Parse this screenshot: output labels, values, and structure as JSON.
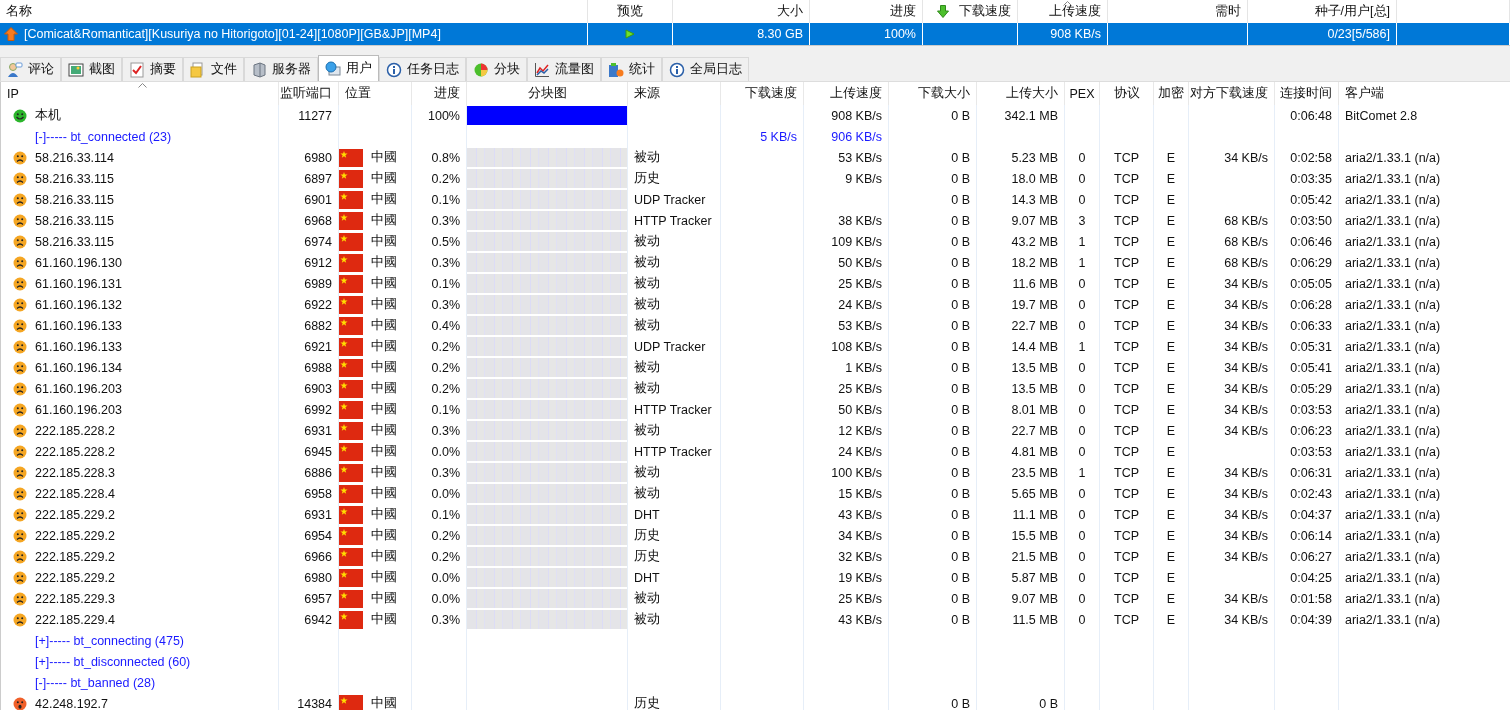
{
  "torrents": {
    "columns": [
      {
        "label": "名称",
        "sorted": false
      },
      {
        "label": "预览",
        "sorted": false
      },
      {
        "label": "大小",
        "sorted": false
      },
      {
        "label": "进度",
        "sorted": false
      },
      {
        "label": "下载速度",
        "sorted": false
      },
      {
        "label": "上传速度",
        "sorted": true
      },
      {
        "label": "需时",
        "sorted": false
      },
      {
        "label": "种子/用户[总]",
        "sorted": false
      }
    ],
    "rows": [
      {
        "selected": true,
        "name": "[Comicat&Romanticat][Kusuriya no Hitorigoto][01-24][1080P][GB&JP][MP4]",
        "size": "8.30 GB",
        "progress": "100%",
        "down": "",
        "up": "908 KB/s",
        "eta": "",
        "peers": "0/23[5/586]"
      }
    ]
  },
  "tabs": [
    {
      "label": "评论",
      "kind": "comment",
      "selected": false
    },
    {
      "label": "截图",
      "kind": "picture",
      "selected": false
    },
    {
      "label": "摘要",
      "kind": "check",
      "selected": false
    },
    {
      "label": "文件",
      "kind": "files",
      "selected": false
    },
    {
      "label": "服务器",
      "kind": "server",
      "selected": false
    },
    {
      "label": "用户",
      "kind": "users",
      "selected": true
    },
    {
      "label": "任务日志",
      "kind": "info",
      "selected": false
    },
    {
      "label": "分块",
      "kind": "pie",
      "selected": false
    },
    {
      "label": "流量图",
      "kind": "chart",
      "selected": false
    },
    {
      "label": "统计",
      "kind": "stats",
      "selected": false
    },
    {
      "label": "全局日志",
      "kind": "info",
      "selected": false
    }
  ],
  "peers": {
    "columns": [
      {
        "label": "IP",
        "sorted": true
      },
      {
        "label": "监听端口",
        "sorted": false
      },
      {
        "label": "位置",
        "sorted": false
      },
      {
        "label": "进度",
        "sorted": false
      },
      {
        "label": "分块图",
        "sorted": false
      },
      {
        "label": "来源",
        "sorted": false
      },
      {
        "label": "下载速度",
        "sorted": false
      },
      {
        "label": "上传速度",
        "sorted": false
      },
      {
        "label": "下载大小",
        "sorted": false
      },
      {
        "label": "上传大小",
        "sorted": false
      },
      {
        "label": "PEX",
        "sorted": false
      },
      {
        "label": "协议",
        "sorted": false
      },
      {
        "label": "加密",
        "sorted": false
      },
      {
        "label": "对方下载速度",
        "sorted": false
      },
      {
        "label": "连接时间",
        "sorted": false
      },
      {
        "label": "客户端",
        "sorted": false
      }
    ],
    "rows": [
      {
        "kind": "local",
        "ip": "本机",
        "port": "11277",
        "progress": "100%",
        "level": 1,
        "up": "908 KB/s",
        "down_size": "0 B",
        "up_size": "342.1 MB",
        "time": "0:06:48",
        "client": "BitComet 2.8"
      },
      {
        "kind": "group",
        "label": "[-]----- bt_connected (23)",
        "down": "5 KB/s",
        "up": "906 KB/s"
      },
      {
        "kind": "peer",
        "ip": "58.216.33.114",
        "port": "6980",
        "country": "中國",
        "progress": "0.8%",
        "source": "被动",
        "up": "53 KB/s",
        "down_size": "0 B",
        "up_size": "5.23 MB",
        "pex": "0",
        "protocol": "TCP",
        "encryption": "E",
        "peer_down": "34 KB/s",
        "time": "0:02:58",
        "client": "aria2/1.33.1 (n/a)"
      },
      {
        "kind": "peer",
        "ip": "58.216.33.115",
        "port": "6897",
        "country": "中國",
        "progress": "0.2%",
        "source": "历史",
        "up": "9 KB/s",
        "down_size": "0 B",
        "up_size": "18.0 MB",
        "pex": "0",
        "protocol": "TCP",
        "encryption": "E",
        "time": "0:03:35",
        "client": "aria2/1.33.1 (n/a)"
      },
      {
        "kind": "peer",
        "ip": "58.216.33.115",
        "port": "6901",
        "country": "中國",
        "progress": "0.1%",
        "source": "UDP Tracker",
        "down_size": "0 B",
        "up_size": "14.3 MB",
        "pex": "0",
        "protocol": "TCP",
        "encryption": "E",
        "time": "0:05:42",
        "client": "aria2/1.33.1 (n/a)"
      },
      {
        "kind": "peer",
        "ip": "58.216.33.115",
        "port": "6968",
        "country": "中國",
        "progress": "0.3%",
        "source": "HTTP Tracker",
        "up": "38 KB/s",
        "down_size": "0 B",
        "up_size": "9.07 MB",
        "pex": "3",
        "protocol": "TCP",
        "encryption": "E",
        "peer_down": "68 KB/s",
        "time": "0:03:50",
        "client": "aria2/1.33.1 (n/a)"
      },
      {
        "kind": "peer",
        "ip": "58.216.33.115",
        "port": "6974",
        "country": "中國",
        "progress": "0.5%",
        "source": "被动",
        "up": "109 KB/s",
        "down_size": "0 B",
        "up_size": "43.2 MB",
        "pex": "1",
        "protocol": "TCP",
        "encryption": "E",
        "peer_down": "68 KB/s",
        "time": "0:06:46",
        "client": "aria2/1.33.1 (n/a)"
      },
      {
        "kind": "peer",
        "ip": "61.160.196.130",
        "port": "6912",
        "country": "中國",
        "progress": "0.3%",
        "source": "被动",
        "up": "50 KB/s",
        "down_size": "0 B",
        "up_size": "18.2 MB",
        "pex": "1",
        "protocol": "TCP",
        "encryption": "E",
        "peer_down": "68 KB/s",
        "time": "0:06:29",
        "client": "aria2/1.33.1 (n/a)"
      },
      {
        "kind": "peer",
        "ip": "61.160.196.131",
        "port": "6989",
        "country": "中國",
        "progress": "0.1%",
        "source": "被动",
        "up": "25 KB/s",
        "down_size": "0 B",
        "up_size": "11.6 MB",
        "pex": "0",
        "protocol": "TCP",
        "encryption": "E",
        "peer_down": "34 KB/s",
        "time": "0:05:05",
        "client": "aria2/1.33.1 (n/a)"
      },
      {
        "kind": "peer",
        "ip": "61.160.196.132",
        "port": "6922",
        "country": "中國",
        "progress": "0.3%",
        "source": "被动",
        "up": "24 KB/s",
        "down_size": "0 B",
        "up_size": "19.7 MB",
        "pex": "0",
        "protocol": "TCP",
        "encryption": "E",
        "peer_down": "34 KB/s",
        "time": "0:06:28",
        "client": "aria2/1.33.1 (n/a)"
      },
      {
        "kind": "peer",
        "ip": "61.160.196.133",
        "port": "6882",
        "country": "中國",
        "progress": "0.4%",
        "source": "被动",
        "up": "53 KB/s",
        "down_size": "0 B",
        "up_size": "22.7 MB",
        "pex": "0",
        "protocol": "TCP",
        "encryption": "E",
        "peer_down": "34 KB/s",
        "time": "0:06:33",
        "client": "aria2/1.33.1 (n/a)"
      },
      {
        "kind": "peer",
        "ip": "61.160.196.133",
        "port": "6921",
        "country": "中國",
        "progress": "0.2%",
        "source": "UDP Tracker",
        "up": "108 KB/s",
        "down_size": "0 B",
        "up_size": "14.4 MB",
        "pex": "1",
        "protocol": "TCP",
        "encryption": "E",
        "peer_down": "34 KB/s",
        "time": "0:05:31",
        "client": "aria2/1.33.1 (n/a)"
      },
      {
        "kind": "peer",
        "ip": "61.160.196.134",
        "port": "6988",
        "country": "中國",
        "progress": "0.2%",
        "source": "被动",
        "up": "1 KB/s",
        "down_size": "0 B",
        "up_size": "13.5 MB",
        "pex": "0",
        "protocol": "TCP",
        "encryption": "E",
        "peer_down": "34 KB/s",
        "time": "0:05:41",
        "client": "aria2/1.33.1 (n/a)"
      },
      {
        "kind": "peer",
        "ip": "61.160.196.203",
        "port": "6903",
        "country": "中國",
        "progress": "0.2%",
        "source": "被动",
        "up": "25 KB/s",
        "down_size": "0 B",
        "up_size": "13.5 MB",
        "pex": "0",
        "protocol": "TCP",
        "encryption": "E",
        "peer_down": "34 KB/s",
        "time": "0:05:29",
        "client": "aria2/1.33.1 (n/a)"
      },
      {
        "kind": "peer",
        "ip": "61.160.196.203",
        "port": "6992",
        "country": "中國",
        "progress": "0.1%",
        "source": "HTTP Tracker",
        "up": "50 KB/s",
        "down_size": "0 B",
        "up_size": "8.01 MB",
        "pex": "0",
        "protocol": "TCP",
        "encryption": "E",
        "peer_down": "34 KB/s",
        "time": "0:03:53",
        "client": "aria2/1.33.1 (n/a)"
      },
      {
        "kind": "peer",
        "ip": "222.185.228.2",
        "port": "6931",
        "country": "中國",
        "progress": "0.3%",
        "source": "被动",
        "up": "12 KB/s",
        "down_size": "0 B",
        "up_size": "22.7 MB",
        "pex": "0",
        "protocol": "TCP",
        "encryption": "E",
        "peer_down": "34 KB/s",
        "time": "0:06:23",
        "client": "aria2/1.33.1 (n/a)"
      },
      {
        "kind": "peer",
        "ip": "222.185.228.2",
        "port": "6945",
        "country": "中國",
        "progress": "0.0%",
        "source": "HTTP Tracker",
        "up": "24 KB/s",
        "down_size": "0 B",
        "up_size": "4.81 MB",
        "pex": "0",
        "protocol": "TCP",
        "encryption": "E",
        "time": "0:03:53",
        "client": "aria2/1.33.1 (n/a)"
      },
      {
        "kind": "peer",
        "ip": "222.185.228.3",
        "port": "6886",
        "country": "中國",
        "progress": "0.3%",
        "source": "被动",
        "up": "100 KB/s",
        "down_size": "0 B",
        "up_size": "23.5 MB",
        "pex": "1",
        "protocol": "TCP",
        "encryption": "E",
        "peer_down": "34 KB/s",
        "time": "0:06:31",
        "client": "aria2/1.33.1 (n/a)"
      },
      {
        "kind": "peer",
        "ip": "222.185.228.4",
        "port": "6958",
        "country": "中國",
        "progress": "0.0%",
        "source": "被动",
        "up": "15 KB/s",
        "down_size": "0 B",
        "up_size": "5.65 MB",
        "pex": "0",
        "protocol": "TCP",
        "encryption": "E",
        "peer_down": "34 KB/s",
        "time": "0:02:43",
        "client": "aria2/1.33.1 (n/a)"
      },
      {
        "kind": "peer",
        "ip": "222.185.229.2",
        "port": "6931",
        "country": "中國",
        "progress": "0.1%",
        "source": "DHT",
        "up": "43 KB/s",
        "down_size": "0 B",
        "up_size": "11.1 MB",
        "pex": "0",
        "protocol": "TCP",
        "encryption": "E",
        "peer_down": "34 KB/s",
        "time": "0:04:37",
        "client": "aria2/1.33.1 (n/a)"
      },
      {
        "kind": "peer",
        "ip": "222.185.229.2",
        "port": "6954",
        "country": "中國",
        "progress": "0.2%",
        "source": "历史",
        "up": "34 KB/s",
        "down_size": "0 B",
        "up_size": "15.5 MB",
        "pex": "0",
        "protocol": "TCP",
        "encryption": "E",
        "peer_down": "34 KB/s",
        "time": "0:06:14",
        "client": "aria2/1.33.1 (n/a)"
      },
      {
        "kind": "peer",
        "ip": "222.185.229.2",
        "port": "6966",
        "country": "中國",
        "progress": "0.2%",
        "source": "历史",
        "up": "32 KB/s",
        "down_size": "0 B",
        "up_size": "21.5 MB",
        "pex": "0",
        "protocol": "TCP",
        "encryption": "E",
        "peer_down": "34 KB/s",
        "time": "0:06:27",
        "client": "aria2/1.33.1 (n/a)"
      },
      {
        "kind": "peer",
        "ip": "222.185.229.2",
        "port": "6980",
        "country": "中國",
        "progress": "0.0%",
        "source": "DHT",
        "up": "19 KB/s",
        "down_size": "0 B",
        "up_size": "5.87 MB",
        "pex": "0",
        "protocol": "TCP",
        "encryption": "E",
        "time": "0:04:25",
        "client": "aria2/1.33.1 (n/a)"
      },
      {
        "kind": "peer",
        "ip": "222.185.229.3",
        "port": "6957",
        "country": "中國",
        "progress": "0.0%",
        "source": "被动",
        "up": "25 KB/s",
        "down_size": "0 B",
        "up_size": "9.07 MB",
        "pex": "0",
        "protocol": "TCP",
        "encryption": "E",
        "peer_down": "34 KB/s",
        "time": "0:01:58",
        "client": "aria2/1.33.1 (n/a)"
      },
      {
        "kind": "peer",
        "ip": "222.185.229.4",
        "port": "6942",
        "country": "中國",
        "progress": "0.3%",
        "source": "被动",
        "up": "43 KB/s",
        "down_size": "0 B",
        "up_size": "11.5 MB",
        "pex": "0",
        "protocol": "TCP",
        "encryption": "E",
        "peer_down": "34 KB/s",
        "time": "0:04:39",
        "client": "aria2/1.33.1 (n/a)"
      },
      {
        "kind": "group",
        "label": "[+]----- bt_connecting (475)"
      },
      {
        "kind": "group",
        "label": "[+]----- bt_disconnected (60)"
      },
      {
        "kind": "group",
        "label": "[-]----- bt_banned (28)"
      },
      {
        "kind": "banned",
        "ip": "42.248.192.7",
        "port": "14384",
        "country": "中國",
        "source": "历史",
        "down_size": "0 B",
        "up_size": "0 B"
      }
    ]
  }
}
